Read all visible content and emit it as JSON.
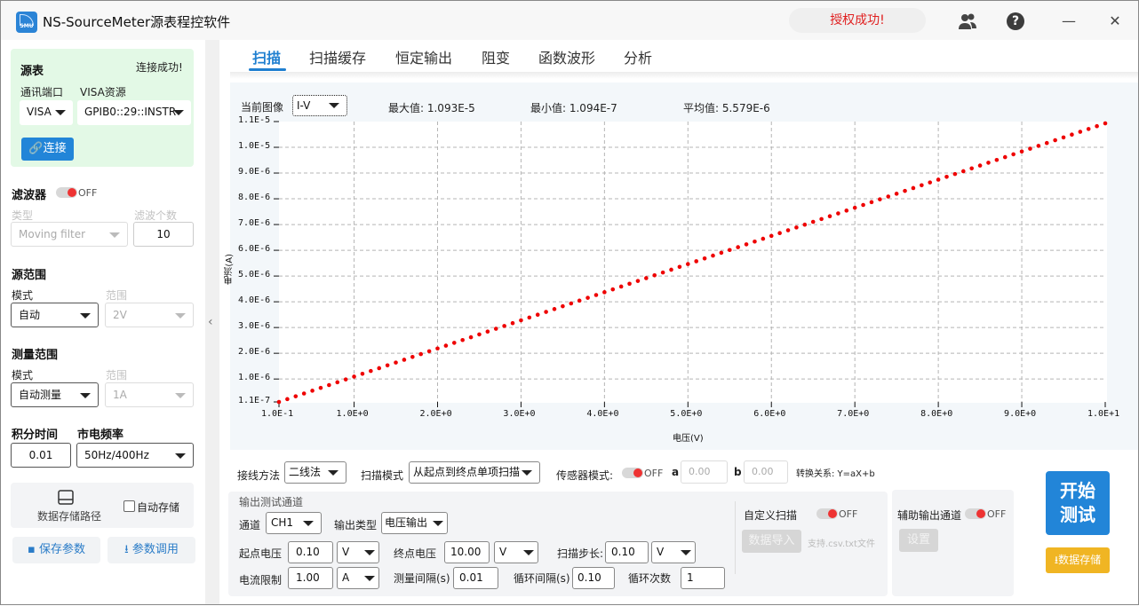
{
  "app": {
    "title": "NS-SourceMeter源表程控软件",
    "logo_text": "SMU",
    "auth_status": "授权成功!"
  },
  "titlebar_icons": {
    "users": "users-icon",
    "help": "?",
    "minimize": "—",
    "close": "✕"
  },
  "sidebar": {
    "source": {
      "title": "源表",
      "status": "连接成功!",
      "port_label": "通讯端口",
      "port_value": "VISA",
      "visa_label": "VISA资源",
      "visa_value": "GPIB0::29::INSTR",
      "connect_label": "连接"
    },
    "filter": {
      "title": "滤波器",
      "toggle": "OFF",
      "type_label": "类型",
      "type_value": "Moving filter",
      "count_label": "滤波个数",
      "count_value": "10"
    },
    "source_range": {
      "title": "源范围",
      "mode_label": "模式",
      "mode_value": "自动",
      "range_label": "范围",
      "range_value": "2V"
    },
    "measure_range": {
      "title": "测量范围",
      "mode_label": "模式",
      "mode_value": "自动测量",
      "range_label": "范围",
      "range_value": "1A"
    },
    "integration": {
      "label": "积分时间",
      "value": "0.01"
    },
    "power_freq": {
      "label": "市电频率",
      "value": "50Hz/400Hz"
    },
    "storage": {
      "path_label": "数据存储路径",
      "auto_save_label": "自动存储",
      "auto_save_checked": false
    },
    "save_params_label": "保存参数",
    "load_params_label": "参数调用"
  },
  "tabs": [
    {
      "label": "扫描",
      "active": true
    },
    {
      "label": "扫描缓存",
      "active": false
    },
    {
      "label": "恒定输出",
      "active": false
    },
    {
      "label": "阻变",
      "active": false
    },
    {
      "label": "函数波形",
      "active": false
    },
    {
      "label": "分析",
      "active": false
    }
  ],
  "chart_header": {
    "current_image_label": "当前图像",
    "current_image_value": "I-V",
    "max_label": "最大值: 1.093E-5",
    "min_label": "最小值: 1.094E-7",
    "avg_label": "平均值: 5.579E-6"
  },
  "chart_data": {
    "type": "scatter",
    "title": "",
    "xlabel": "电压(V)",
    "ylabel": "电流(A)",
    "xlim": [
      0.1,
      10
    ],
    "ylim": [
      1.1e-07,
      1.1e-05
    ],
    "grid": true,
    "x_ticks": [
      0.1,
      1,
      2,
      3,
      4,
      5,
      6,
      7,
      8,
      9,
      10
    ],
    "x_tick_labels": [
      "1.0E-1",
      "1.0E+0",
      "2.0E+0",
      "3.0E+0",
      "4.0E+0",
      "5.0E+0",
      "6.0E+0",
      "7.0E+0",
      "8.0E+0",
      "9.0E+0",
      "1.0E+1"
    ],
    "y_ticks": [
      1.1e-07,
      1e-06,
      2e-06,
      3e-06,
      4e-06,
      5e-06,
      6e-06,
      7e-06,
      8e-06,
      9e-06,
      1e-05,
      1.1e-05
    ],
    "y_tick_labels": [
      "1.1E-7",
      "1.0E-6",
      "2.0E-6",
      "3.0E-6",
      "4.0E-6",
      "5.0E-6",
      "6.0E-6",
      "7.0E-6",
      "8.0E-6",
      "9.0E-6",
      "1.0E-5",
      "1.1E-5"
    ],
    "series": [
      {
        "name": "I-V",
        "color": "#ee0000",
        "x_start": 0.1,
        "x_end": 10,
        "x_step": 0.1,
        "y_start": 1.094e-07,
        "y_end": 1.093e-05,
        "relation": "linear"
      }
    ]
  },
  "controls": {
    "wiring_label": "接线方法",
    "wiring_value": "二线法",
    "scan_mode_label": "扫描模式",
    "scan_mode_value": "从起点到终点单项扫描",
    "sensor_label": "传感器模式:",
    "sensor_toggle": "OFF",
    "a_label": "a",
    "a_value": "0.00",
    "b_label": "b",
    "b_value": "0.00",
    "formula": "转换关系: Y=aX+b",
    "output_group_title": "输出测试通道",
    "channel_label": "通道",
    "channel_value": "CH1",
    "output_type_label": "输出类型",
    "output_type_value": "电压输出",
    "start_v_label": "起点电压",
    "start_v_value": "0.10",
    "start_v_unit": "V",
    "end_v_label": "终点电压",
    "end_v_value": "10.00",
    "end_v_unit": "V",
    "step_label": "扫描步长:",
    "step_value": "0.10",
    "step_unit": "V",
    "current_limit_label": "电流限制",
    "current_limit_value": "1.00",
    "current_limit_unit": "A",
    "measure_interval_label": "测量间隔(s)",
    "measure_interval_value": "0.01",
    "loop_interval_label": "循环间隔(s)",
    "loop_interval_value": "0.10",
    "loop_count_label": "循环次数",
    "loop_count_value": "1",
    "custom_scan_label": "自定义扫描",
    "custom_scan_toggle": "OFF",
    "import_label": "数据导入",
    "import_hint": "支持.csv.txt文件",
    "aux_label": "辅助输出通道",
    "aux_toggle": "OFF",
    "aux_setup_label": "设置",
    "start_label_1": "开始",
    "start_label_2": "测试",
    "data_save_label": "数据存储"
  }
}
